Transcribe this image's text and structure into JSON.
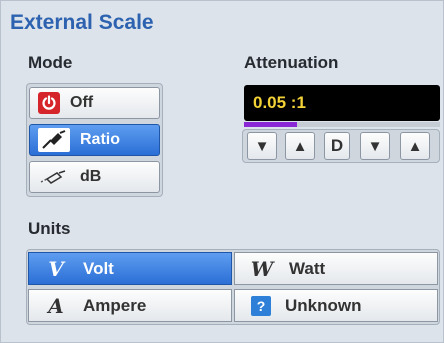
{
  "title": "External Scale",
  "mode": {
    "label": "Mode",
    "options": [
      {
        "label": "Off",
        "icon": "power-icon",
        "selected": false
      },
      {
        "label": "Ratio",
        "icon": "probe-icon",
        "selected": true
      },
      {
        "label": "dB",
        "icon": "probe-outline-icon",
        "selected": false
      }
    ]
  },
  "attenuation": {
    "label": "Attenuation",
    "value": "0.05 :1",
    "level_fraction": 0.27,
    "controls": [
      {
        "glyph": "▼",
        "icon": "arrow-down-icon"
      },
      {
        "glyph": "▲",
        "icon": "arrow-up-icon"
      },
      {
        "glyph": "D",
        "icon": "default-icon"
      },
      {
        "glyph": "▼",
        "icon": "arrow-down-icon"
      },
      {
        "glyph": "▲",
        "icon": "arrow-up-icon"
      }
    ]
  },
  "units": {
    "label": "Units",
    "options": [
      {
        "label": "Volt",
        "glyph": "V",
        "selected": true
      },
      {
        "label": "Watt",
        "glyph": "W",
        "selected": false
      },
      {
        "label": "Ampere",
        "glyph": "A",
        "selected": false
      },
      {
        "label": "Unknown",
        "glyph": "?",
        "selected": false
      }
    ]
  },
  "colors": {
    "title": "#2c62b0",
    "selected": "#2b6fd6",
    "display_bg": "#000000",
    "display_text": "#f2d236",
    "level_bar": "#8a28d6",
    "power": "#d6252a"
  }
}
